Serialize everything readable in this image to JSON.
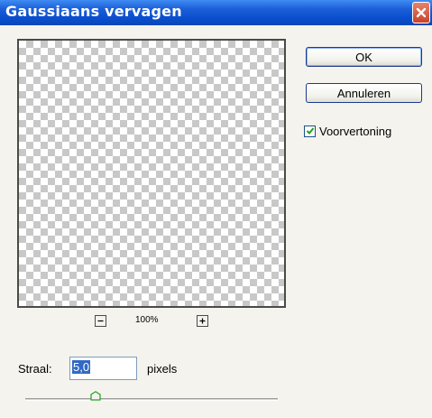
{
  "window": {
    "title": "Gaussiaans vervagen"
  },
  "buttons": {
    "ok_label": "OK",
    "cancel_label": "Annuleren"
  },
  "preview_option": {
    "label": "Voorvertoning",
    "checked": true
  },
  "zoom": {
    "level": "100%"
  },
  "radius": {
    "label": "Straal:",
    "value": "5,0",
    "unit": "pixels",
    "slider_fraction": 0.28
  },
  "colors": {
    "titlebar": "#0a4fcf",
    "close": "#c8432a",
    "dialog_bg": "#f4f3ee",
    "selection": "#316ac5"
  }
}
